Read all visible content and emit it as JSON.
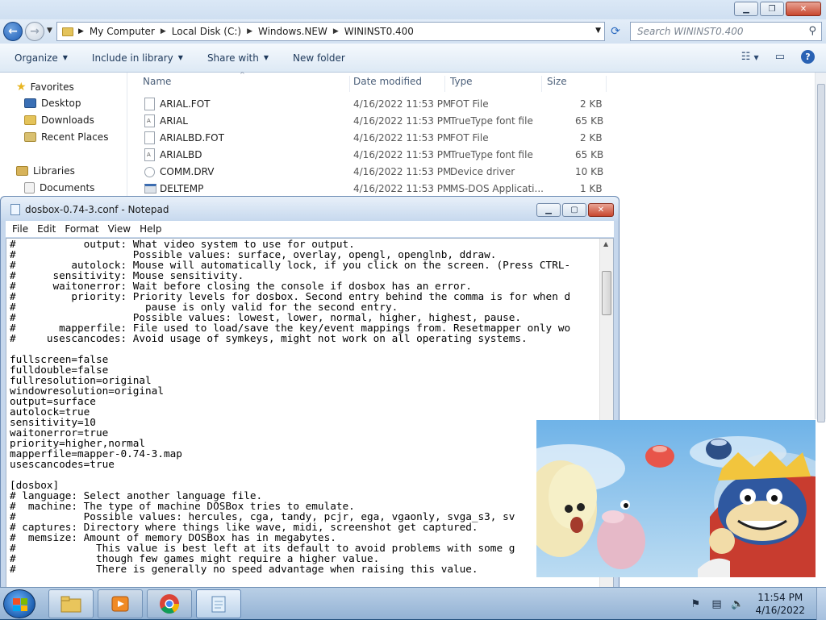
{
  "explorer": {
    "breadcrumb": [
      "My Computer",
      "Local Disk (C:)",
      "Windows.NEW",
      "WININST0.400"
    ],
    "search_placeholder": "Search WININST0.400",
    "toolbar": {
      "organize": "Organize",
      "include_in_library": "Include in library",
      "share_with": "Share with",
      "new_folder": "New folder"
    },
    "nav": {
      "favorites": "Favorites",
      "desktop": "Desktop",
      "downloads": "Downloads",
      "recent_places": "Recent Places",
      "libraries": "Libraries",
      "documents": "Documents"
    },
    "columns": {
      "name": "Name",
      "date_modified": "Date modified",
      "type": "Type",
      "size": "Size"
    },
    "files": [
      {
        "name": "ARIAL.FOT",
        "date": "4/16/2022 11:53 PM",
        "type": "FOT File",
        "size": "2 KB"
      },
      {
        "name": "ARIAL",
        "date": "4/16/2022 11:53 PM",
        "type": "TrueType font file",
        "size": "65 KB"
      },
      {
        "name": "ARIALBD.FOT",
        "date": "4/16/2022 11:53 PM",
        "type": "FOT File",
        "size": "2 KB"
      },
      {
        "name": "ARIALBD",
        "date": "4/16/2022 11:53 PM",
        "type": "TrueType font file",
        "size": "65 KB"
      },
      {
        "name": "COMM.DRV",
        "date": "4/16/2022 11:53 PM",
        "type": "Device driver",
        "size": "10 KB"
      },
      {
        "name": "DELTEMP",
        "date": "4/16/2022 11:53 PM",
        "type": "MS-DOS Applicati...",
        "size": "1 KB"
      }
    ]
  },
  "notepad": {
    "title": "dosbox-0.74-3.conf - Notepad",
    "menu": [
      "File",
      "Edit",
      "Format",
      "View",
      "Help"
    ],
    "lines": [
      "#           output: What video system to use for output.",
      "#                   Possible values: surface, overlay, opengl, openglnb, ddraw.",
      "#         autolock: Mouse will automatically lock, if you click on the screen. (Press CTRL-",
      "#      sensitivity: Mouse sensitivity.",
      "#      waitonerror: Wait before closing the console if dosbox has an error.",
      "#         priority: Priority levels for dosbox. Second entry behind the comma is for when d",
      "#                     pause is only valid for the second entry.",
      "#                   Possible values: lowest, lower, normal, higher, highest, pause.",
      "#       mapperfile: File used to load/save the key/event mappings from. Resetmapper only wo",
      "#     usescancodes: Avoid usage of symkeys, might not work on all operating systems.",
      "",
      "fullscreen=false",
      "fulldouble=false",
      "fullresolution=original",
      "windowresolution=original",
      "output=surface",
      "autolock=true",
      "sensitivity=10",
      "waitonerror=true",
      "priority=higher,normal",
      "mapperfile=mapper-0.74-3.map",
      "usescancodes=true",
      "",
      "[dosbox]",
      "# language: Select another language file.",
      "#  machine: The type of machine DOSBox tries to emulate.",
      "#           Possible values: hercules, cga, tandy, pcjr, ega, vgaonly, svga_s3, sv",
      "# captures: Directory where things like wave, midi, screenshot get captured.",
      "#  memsize: Amount of memory DOSBox has in megabytes.",
      "#             This value is best left at its default to avoid problems with some g",
      "#             though few games might require a higher value.",
      "#             There is generally no speed advantage when raising this value."
    ]
  },
  "taskbar": {
    "time": "11:54 PM",
    "date": "4/16/2022"
  }
}
